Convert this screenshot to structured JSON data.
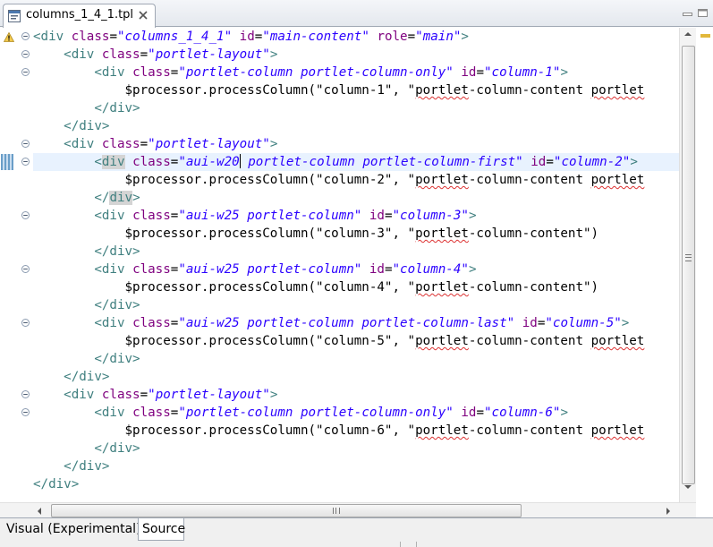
{
  "editor_tab": {
    "title": "columns_1_4_1.tpl",
    "file_icon": "template-file-icon",
    "close_icon": "close-icon"
  },
  "window_controls": {
    "minimize_icon": "minimize-icon",
    "maximize_icon": "maximize-icon"
  },
  "code_lines": [
    {
      "indent": "",
      "tokens": [
        {
          "t": "tag",
          "v": "<div"
        },
        {
          "t": "plain",
          "v": " "
        },
        {
          "t": "attr",
          "v": "class"
        },
        {
          "t": "plain",
          "v": "="
        },
        {
          "t": "val",
          "v": "\"columns_1_4_1\""
        },
        {
          "t": "plain",
          "v": " "
        },
        {
          "t": "attr",
          "v": "id"
        },
        {
          "t": "plain",
          "v": "="
        },
        {
          "t": "val",
          "v": "\"main-content\""
        },
        {
          "t": "plain",
          "v": " "
        },
        {
          "t": "attr",
          "v": "role"
        },
        {
          "t": "plain",
          "v": "="
        },
        {
          "t": "val",
          "v": "\"main\""
        },
        {
          "t": "tag",
          "v": ">"
        }
      ]
    },
    {
      "indent": "    ",
      "tokens": [
        {
          "t": "tag",
          "v": "<div"
        },
        {
          "t": "plain",
          "v": " "
        },
        {
          "t": "attr",
          "v": "class"
        },
        {
          "t": "plain",
          "v": "="
        },
        {
          "t": "val",
          "v": "\"portlet-layout\""
        },
        {
          "t": "tag",
          "v": ">"
        }
      ]
    },
    {
      "indent": "        ",
      "tokens": [
        {
          "t": "tag",
          "v": "<div"
        },
        {
          "t": "plain",
          "v": " "
        },
        {
          "t": "attr",
          "v": "class"
        },
        {
          "t": "plain",
          "v": "="
        },
        {
          "t": "val",
          "v": "\"portlet-column portlet-column-only\""
        },
        {
          "t": "plain",
          "v": " "
        },
        {
          "t": "attr",
          "v": "id"
        },
        {
          "t": "plain",
          "v": "="
        },
        {
          "t": "val",
          "v": "\"column-1\""
        },
        {
          "t": "tag",
          "v": ">"
        }
      ]
    },
    {
      "indent": "            ",
      "tokens": [
        {
          "t": "plain",
          "v": "$processor.processColumn(\"column-1\", \""
        },
        {
          "t": "sq",
          "v": "portlet"
        },
        {
          "t": "plain",
          "v": "-column-content "
        },
        {
          "t": "sq",
          "v": "portlet"
        }
      ]
    },
    {
      "indent": "        ",
      "tokens": [
        {
          "t": "tag",
          "v": "</div>"
        }
      ]
    },
    {
      "indent": "    ",
      "tokens": [
        {
          "t": "tag",
          "v": "</div>"
        }
      ]
    },
    {
      "indent": "    ",
      "tokens": [
        {
          "t": "tag",
          "v": "<div"
        },
        {
          "t": "plain",
          "v": " "
        },
        {
          "t": "attr",
          "v": "class"
        },
        {
          "t": "plain",
          "v": "="
        },
        {
          "t": "val",
          "v": "\"portlet-layout\""
        },
        {
          "t": "tag",
          "v": ">"
        }
      ]
    },
    {
      "indent": "        ",
      "current": true,
      "tokens": [
        {
          "t": "tag",
          "v": "<"
        },
        {
          "t": "taghl",
          "v": "div"
        },
        {
          "t": "plain",
          "v": " "
        },
        {
          "t": "attr",
          "v": "class"
        },
        {
          "t": "plain",
          "v": "="
        },
        {
          "t": "val",
          "v": "\"aui-w20"
        },
        {
          "t": "caret",
          "v": ""
        },
        {
          "t": "val",
          "v": " portlet-column portlet-column-first\""
        },
        {
          "t": "plain",
          "v": " "
        },
        {
          "t": "attr",
          "v": "id"
        },
        {
          "t": "plain",
          "v": "="
        },
        {
          "t": "val",
          "v": "\"column-2\""
        },
        {
          "t": "tag",
          "v": ">"
        }
      ]
    },
    {
      "indent": "            ",
      "tokens": [
        {
          "t": "plain",
          "v": "$processor.processColumn(\"column-2\", \""
        },
        {
          "t": "sq",
          "v": "portlet"
        },
        {
          "t": "plain",
          "v": "-column-content "
        },
        {
          "t": "sq",
          "v": "portlet"
        }
      ]
    },
    {
      "indent": "        ",
      "tokens": [
        {
          "t": "tag",
          "v": "</"
        },
        {
          "t": "taghl",
          "v": "div"
        },
        {
          "t": "tag",
          "v": ">"
        }
      ]
    },
    {
      "indent": "        ",
      "tokens": [
        {
          "t": "tag",
          "v": "<div"
        },
        {
          "t": "plain",
          "v": " "
        },
        {
          "t": "attr",
          "v": "class"
        },
        {
          "t": "plain",
          "v": "="
        },
        {
          "t": "val",
          "v": "\"aui-w25 portlet-column\""
        },
        {
          "t": "plain",
          "v": " "
        },
        {
          "t": "attr",
          "v": "id"
        },
        {
          "t": "plain",
          "v": "="
        },
        {
          "t": "val",
          "v": "\"column-3\""
        },
        {
          "t": "tag",
          "v": ">"
        }
      ]
    },
    {
      "indent": "            ",
      "tokens": [
        {
          "t": "plain",
          "v": "$processor.processColumn(\"column-3\", \""
        },
        {
          "t": "sq",
          "v": "portlet"
        },
        {
          "t": "plain",
          "v": "-column-content\")"
        }
      ]
    },
    {
      "indent": "        ",
      "tokens": [
        {
          "t": "tag",
          "v": "</div>"
        }
      ]
    },
    {
      "indent": "        ",
      "tokens": [
        {
          "t": "tag",
          "v": "<div"
        },
        {
          "t": "plain",
          "v": " "
        },
        {
          "t": "attr",
          "v": "class"
        },
        {
          "t": "plain",
          "v": "="
        },
        {
          "t": "val",
          "v": "\"aui-w25 portlet-column\""
        },
        {
          "t": "plain",
          "v": " "
        },
        {
          "t": "attr",
          "v": "id"
        },
        {
          "t": "plain",
          "v": "="
        },
        {
          "t": "val",
          "v": "\"column-4\""
        },
        {
          "t": "tag",
          "v": ">"
        }
      ]
    },
    {
      "indent": "            ",
      "tokens": [
        {
          "t": "plain",
          "v": "$processor.processColumn(\"column-4\", \""
        },
        {
          "t": "sq",
          "v": "portlet"
        },
        {
          "t": "plain",
          "v": "-column-content\")"
        }
      ]
    },
    {
      "indent": "        ",
      "tokens": [
        {
          "t": "tag",
          "v": "</div>"
        }
      ]
    },
    {
      "indent": "        ",
      "tokens": [
        {
          "t": "tag",
          "v": "<div"
        },
        {
          "t": "plain",
          "v": " "
        },
        {
          "t": "attr",
          "v": "class"
        },
        {
          "t": "plain",
          "v": "="
        },
        {
          "t": "val",
          "v": "\"aui-w25 portlet-column portlet-column-last\""
        },
        {
          "t": "plain",
          "v": " "
        },
        {
          "t": "attr",
          "v": "id"
        },
        {
          "t": "plain",
          "v": "="
        },
        {
          "t": "val",
          "v": "\"column-5\""
        },
        {
          "t": "tag",
          "v": ">"
        }
      ]
    },
    {
      "indent": "            ",
      "tokens": [
        {
          "t": "plain",
          "v": "$processor.processColumn(\"column-5\", \""
        },
        {
          "t": "sq",
          "v": "portlet"
        },
        {
          "t": "plain",
          "v": "-column-content "
        },
        {
          "t": "sq",
          "v": "portlet"
        }
      ]
    },
    {
      "indent": "        ",
      "tokens": [
        {
          "t": "tag",
          "v": "</div>"
        }
      ]
    },
    {
      "indent": "    ",
      "tokens": [
        {
          "t": "tag",
          "v": "</div>"
        }
      ]
    },
    {
      "indent": "    ",
      "tokens": [
        {
          "t": "tag",
          "v": "<div"
        },
        {
          "t": "plain",
          "v": " "
        },
        {
          "t": "attr",
          "v": "class"
        },
        {
          "t": "plain",
          "v": "="
        },
        {
          "t": "val",
          "v": "\"portlet-layout\""
        },
        {
          "t": "tag",
          "v": ">"
        }
      ]
    },
    {
      "indent": "        ",
      "tokens": [
        {
          "t": "tag",
          "v": "<div"
        },
        {
          "t": "plain",
          "v": " "
        },
        {
          "t": "attr",
          "v": "class"
        },
        {
          "t": "plain",
          "v": "="
        },
        {
          "t": "val",
          "v": "\"portlet-column portlet-column-only\""
        },
        {
          "t": "plain",
          "v": " "
        },
        {
          "t": "attr",
          "v": "id"
        },
        {
          "t": "plain",
          "v": "="
        },
        {
          "t": "val",
          "v": "\"column-6\""
        },
        {
          "t": "tag",
          "v": ">"
        }
      ]
    },
    {
      "indent": "            ",
      "tokens": [
        {
          "t": "plain",
          "v": "$processor.processColumn(\"column-6\", \""
        },
        {
          "t": "sq",
          "v": "portlet"
        },
        {
          "t": "plain",
          "v": "-column-content "
        },
        {
          "t": "sq",
          "v": "portlet"
        }
      ]
    },
    {
      "indent": "        ",
      "tokens": [
        {
          "t": "tag",
          "v": "</div>"
        }
      ]
    },
    {
      "indent": "    ",
      "tokens": [
        {
          "t": "tag",
          "v": "</div>"
        }
      ]
    },
    {
      "indent": "",
      "tokens": [
        {
          "t": "tag",
          "v": "</div>"
        }
      ]
    }
  ],
  "fold_markers": [
    0,
    1,
    2,
    6,
    7,
    10,
    13,
    16,
    20,
    21
  ],
  "markers": {
    "warning_icon": "warning-icon",
    "change_marker": "change-marker",
    "fold_icon": "collapse-icon"
  },
  "colors": {
    "tag": "#3f7f7f",
    "attribute": "#7f007f",
    "value": "#2a00ff",
    "current_line": "#e8f2fe",
    "warning": "#e2b83b"
  },
  "page_tabs": {
    "visual": "Visual (Experimental)",
    "source": "Source",
    "selected": "Source"
  }
}
